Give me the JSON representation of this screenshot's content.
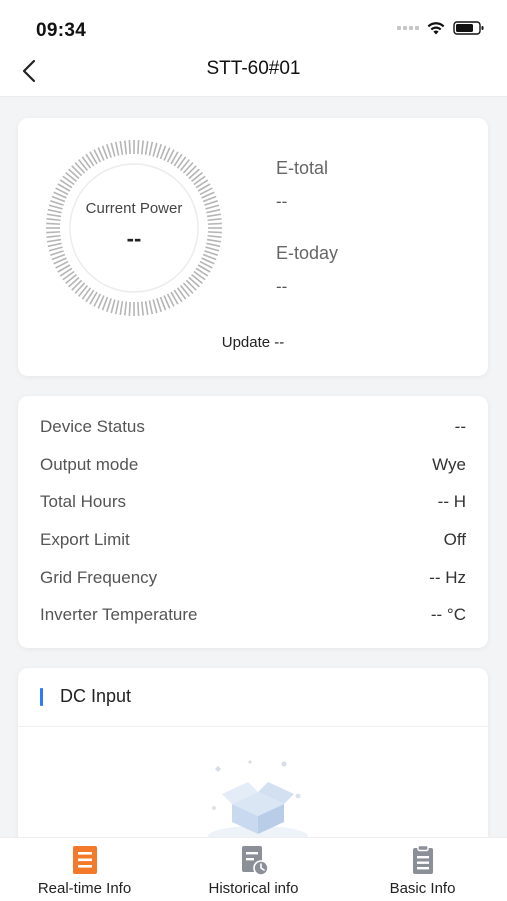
{
  "status_bar": {
    "time": "09:34"
  },
  "nav": {
    "title": "STT-60#01"
  },
  "power_card": {
    "current_power_label": "Current Power",
    "current_power_value": "--",
    "etotal_label": "E-total",
    "etotal_value": "--",
    "etoday_label": "E-today",
    "etoday_value": "--",
    "update_text": "Update --"
  },
  "status": {
    "rows": [
      {
        "label": "Device Status",
        "value": "--"
      },
      {
        "label": "Output mode",
        "value": "Wye"
      },
      {
        "label": "Total Hours",
        "value": "-- H"
      },
      {
        "label": "Export Limit",
        "value": "Off"
      },
      {
        "label": "Grid Frequency",
        "value": "-- Hz"
      },
      {
        "label": "Inverter Temperature",
        "value": "-- °C"
      }
    ]
  },
  "dc_input": {
    "title": "DC Input"
  },
  "tabs": [
    {
      "label": "Real-time Info",
      "icon": "realtime-list-icon",
      "active": true
    },
    {
      "label": "Historical info",
      "icon": "history-clock-icon",
      "active": false
    },
    {
      "label": "Basic Info",
      "icon": "clipboard-icon",
      "active": false
    }
  ],
  "colors": {
    "accent_blue": "#2b7cf5",
    "active_tab_orange": "#f47a2b",
    "inactive_tab_gray": "#8a8f98"
  }
}
